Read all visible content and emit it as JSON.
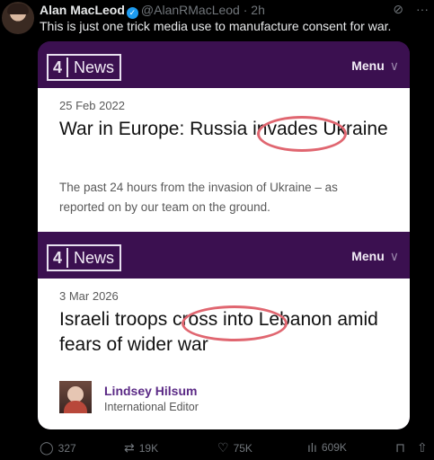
{
  "tweet": {
    "author_name": "Alan MacLeod",
    "handle": "@AlanRMacLeod",
    "time": "2h",
    "text": "This is just one trick media use to manufacture consent for war."
  },
  "icons": {
    "verified": "verified-badge-icon",
    "grok": "grok-icon",
    "more": "more-icon",
    "reply": "reply-icon",
    "retweet": "retweet-icon",
    "like": "like-icon",
    "views": "views-icon",
    "bookmark": "bookmark-icon",
    "share": "share-icon"
  },
  "card1": {
    "logo_num": "4",
    "logo_text": "News",
    "menu": "Menu",
    "date": "25 Feb 2022",
    "headline": "War in Europe: Russia invades Ukraine",
    "standfirst": "The past 24 hours from the invasion of Ukraine – as reported on by our team on the ground."
  },
  "card2": {
    "logo_num": "4",
    "logo_text": "News",
    "menu": "Menu",
    "date": "3 Mar 2026",
    "headline": "Israeli troops cross into Lebanon amid fears of wider war",
    "author_name": "Lindsey Hilsum",
    "author_role": "International Editor"
  },
  "stats": {
    "replies": "327",
    "retweets": "19K",
    "likes": "75K",
    "views": "609K"
  },
  "colors": {
    "bar_purple": "#3b1050",
    "highlight_circle": "#e06670",
    "author_purple": "#5b2a86",
    "verified_blue": "#1d9bf0"
  }
}
